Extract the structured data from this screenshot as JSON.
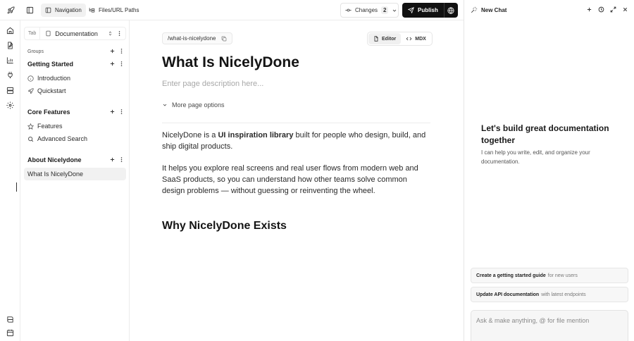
{
  "topbar": {
    "tabs": [
      {
        "label": "Navigation",
        "icon": "layout-icon",
        "active": true
      },
      {
        "label": "Files/URL Paths",
        "icon": "folder-tree-icon",
        "active": false
      }
    ],
    "changes_label": "Changes",
    "changes_count": "2",
    "publish_label": "Publish"
  },
  "sidebar": {
    "tab_label": "Tab",
    "tab_value": "Documentation",
    "groups_label": "Groups",
    "groups": [
      {
        "title": "Getting Started",
        "items": [
          {
            "label": "Introduction",
            "icon": "info-icon"
          },
          {
            "label": "Quickstart",
            "icon": "rocket-icon"
          }
        ]
      },
      {
        "title": "Core Features",
        "items": [
          {
            "label": "Features",
            "icon": "star-icon"
          },
          {
            "label": "Advanced Search",
            "icon": "search-icon"
          }
        ]
      },
      {
        "title": "About Nicelydone",
        "items": [
          {
            "label": "What Is NicelyDone",
            "icon": "",
            "active": true
          }
        ]
      }
    ]
  },
  "editor": {
    "slug": "/what-is-nicelydone",
    "view_tabs": [
      {
        "label": "Editor",
        "active": true
      },
      {
        "label": "MDX",
        "active": false
      }
    ],
    "title": "What Is NicelyDone",
    "description_placeholder": "Enter page description here...",
    "more_options": "More page options",
    "p1": {
      "before": "NicelyDone is a ",
      "bold": "UI inspiration library",
      "after": " built for people who design, build, and ship digital products."
    },
    "p2": "It helps you explore real screens and real user flows from modern web and SaaS products, so you can understand how other teams solve common design problems — without guessing or reinventing the wheel.",
    "h2": "Why NicelyDone Exists"
  },
  "chat": {
    "title": "New Chat",
    "hero_title": "Let's build great documentation together",
    "hero_sub": "I can help you write, edit, and organize your documentation.",
    "suggestions": [
      {
        "bold": "Create a getting started guide",
        "rest": "for new users"
      },
      {
        "bold": "Update API documentation",
        "rest": "with latest endpoints"
      }
    ],
    "input_placeholder": "Ask & make anything, @ for file mention"
  },
  "colors": {
    "publish_bg": "#111111",
    "accent_text": "#141414"
  }
}
